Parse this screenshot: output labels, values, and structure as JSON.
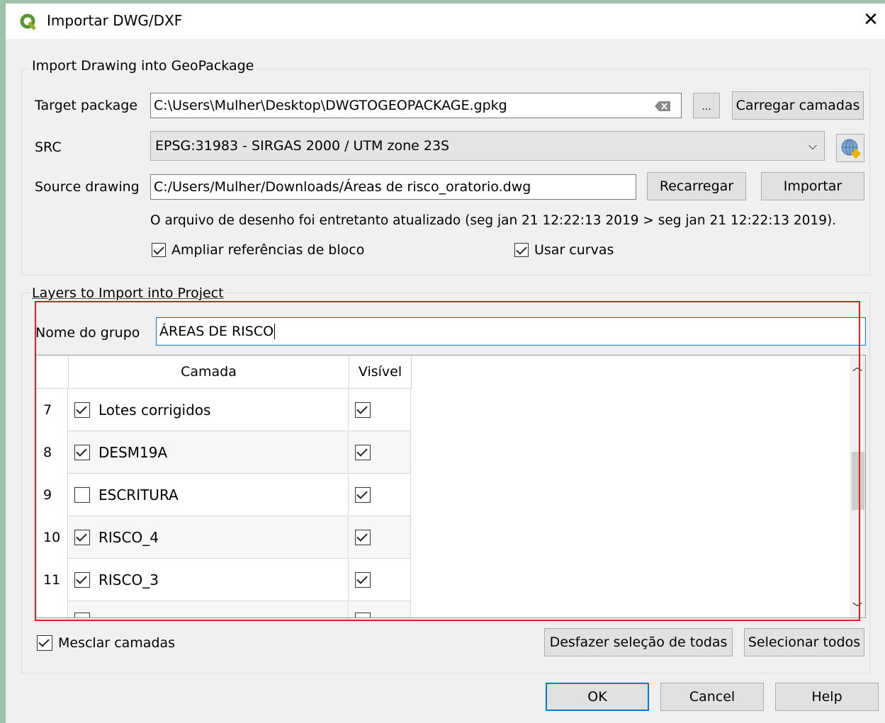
{
  "window": {
    "title": "Importar DWG/DXF",
    "close_icon": "close-icon"
  },
  "import_group": {
    "title": "Import Drawing into GeoPackage",
    "target_package_label": "Target package",
    "target_package_value": "C:\\Users\\Mulher\\Desktop\\DWGTOGEOPACKAGE.gpkg",
    "browse_label": "...",
    "load_layers_label": "Carregar camadas",
    "src_label": "SRC",
    "src_value": "EPSG:31983 - SIRGAS 2000 / UTM zone 23S",
    "source_drawing_label": "Source drawing",
    "source_drawing_value": "C:/Users/Mulher/Downloads/Áreas de risco_oratorio.dwg",
    "reload_label": "Recarregar",
    "import_label": "Importar",
    "status_text": "O arquivo de desenho foi entretanto atualizado (seg jan 21 12:22:13 2019 > seg jan 21 12:22:13 2019).",
    "expand_blocks_label": "Ampliar referências de bloco",
    "expand_blocks_checked": true,
    "use_curves_label": "Usar curvas",
    "use_curves_checked": true
  },
  "layers_group": {
    "title": "Layers to Import into Project",
    "group_name_label": "Nome do grupo",
    "group_name_value": "ÁREAS DE RISCO",
    "col_layer": "Camada",
    "col_visible": "Visível",
    "rows": [
      {
        "num": "7",
        "name": "Lotes corrigidos",
        "checked": true,
        "visible": true
      },
      {
        "num": "8",
        "name": "DESM19A",
        "checked": true,
        "visible": true
      },
      {
        "num": "9",
        "name": "ESCRITURA",
        "checked": false,
        "visible": true
      },
      {
        "num": "10",
        "name": "RISCO_4",
        "checked": true,
        "visible": true
      },
      {
        "num": "11",
        "name": "RISCO_3",
        "checked": true,
        "visible": true
      }
    ],
    "merge_layers_label": "Mesclar camadas",
    "merge_layers_checked": true,
    "deselect_all_label": "Desfazer seleção de todas",
    "select_all_label": "Selecionar todos"
  },
  "footer": {
    "ok_label": "OK",
    "cancel_label": "Cancel",
    "help_label": "Help"
  },
  "colors": {
    "highlight_border": "#e02020",
    "focus_border": "#0078d7"
  }
}
